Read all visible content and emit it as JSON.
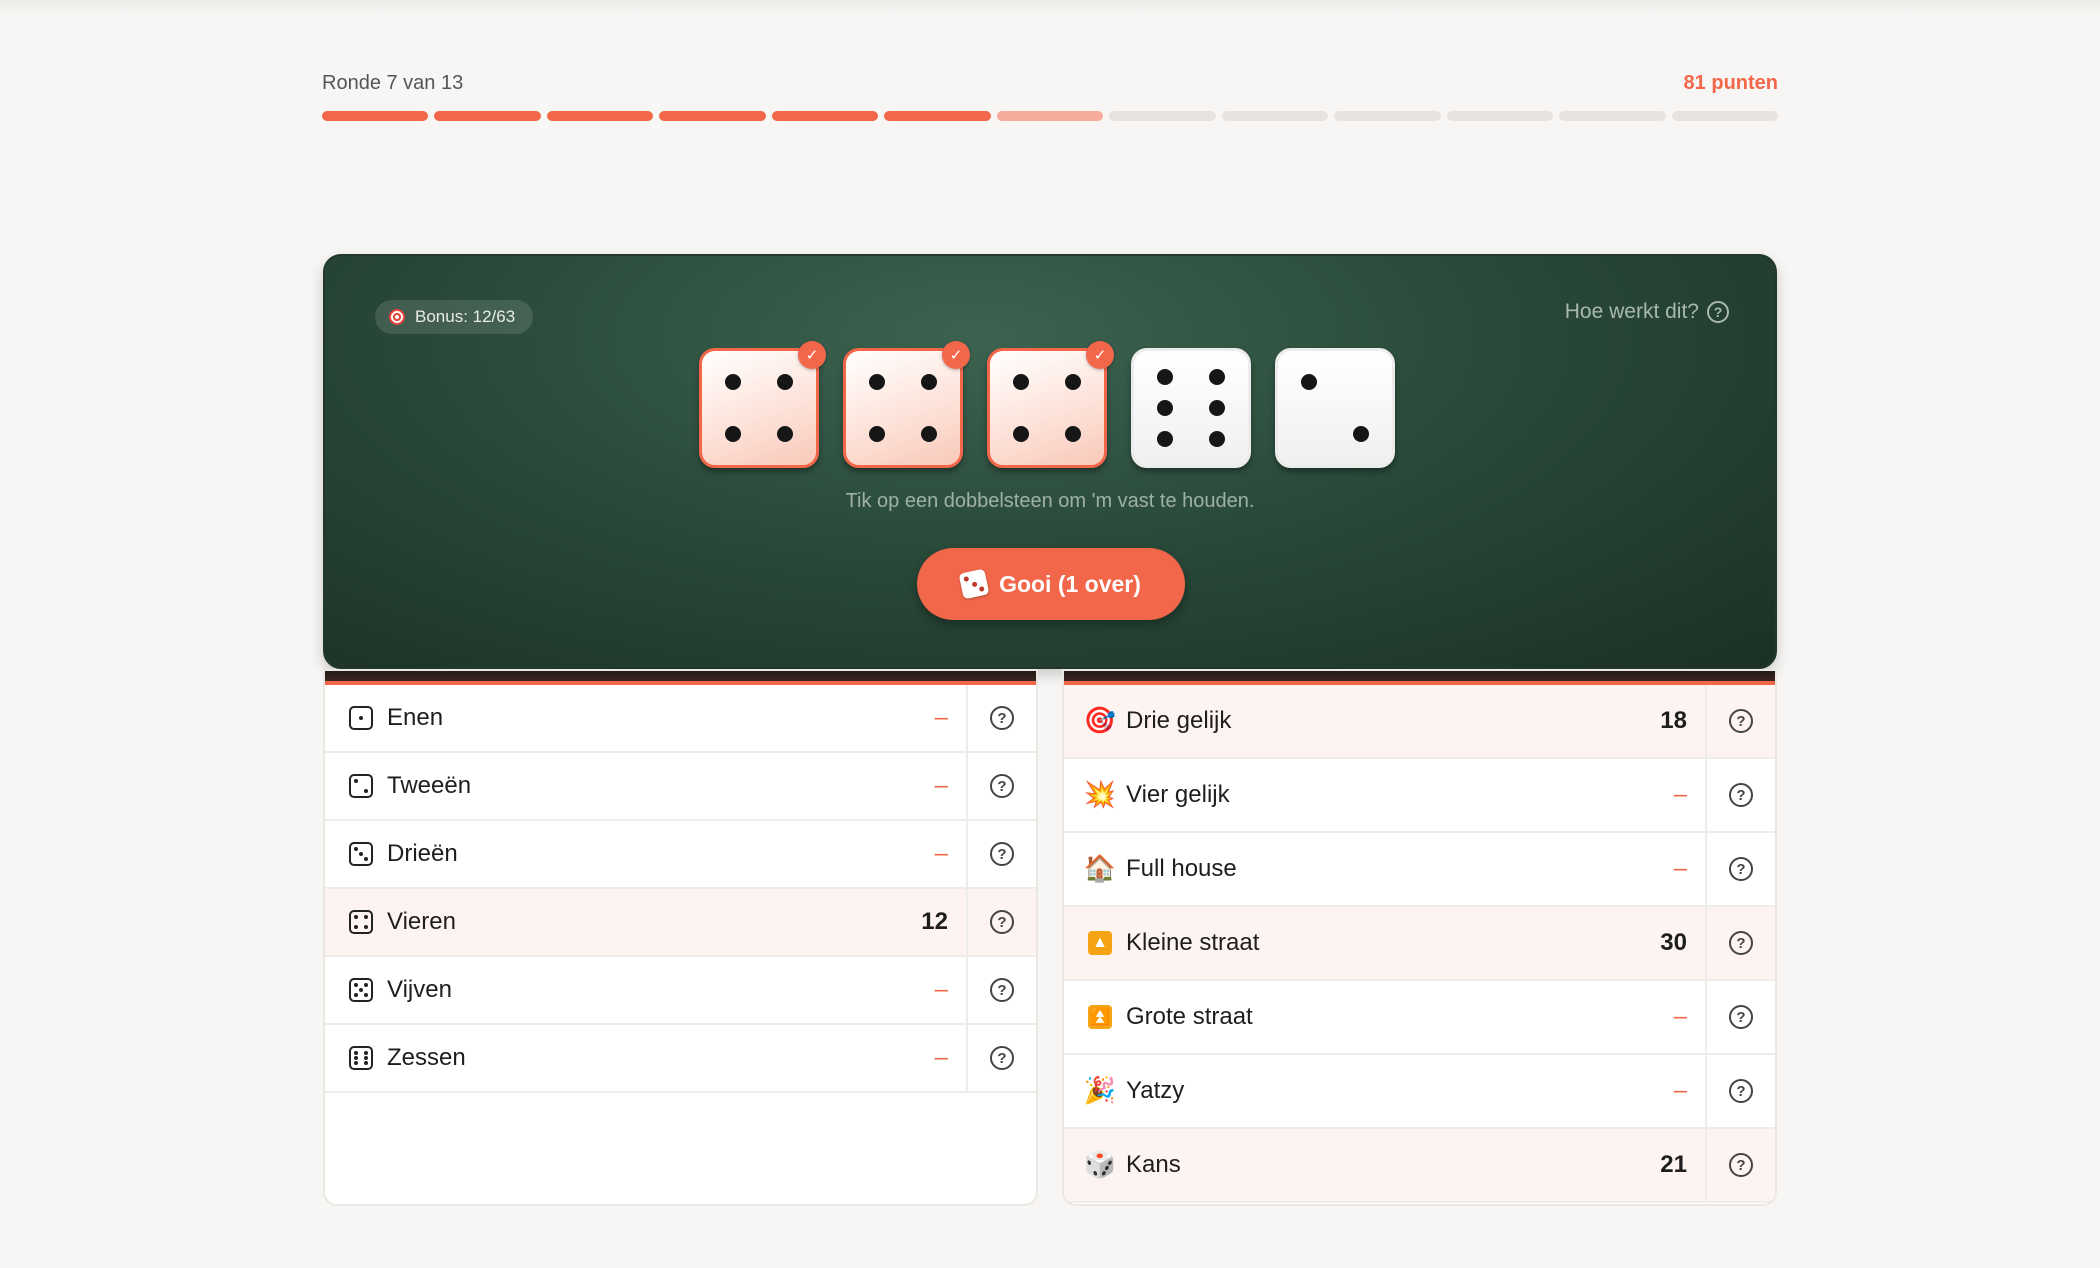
{
  "progress": {
    "round_label": "Ronde 7 van 13",
    "points_label": "81 punten",
    "total_rounds": 13,
    "completed_rounds": 6,
    "current_round": 7,
    "accent_color": "#f26749"
  },
  "table": {
    "bonus_label": "Bonus: 12/63",
    "bonus_icon": "target-icon",
    "how_label": "Hoe werkt dit?",
    "hint": "Tik op een dobbelsteen om 'm vast te houden.",
    "roll_button_label": "Gooi (1 over)",
    "roll_icon": "dice-icon",
    "dice": [
      {
        "value": 4,
        "held": true
      },
      {
        "value": 4,
        "held": true
      },
      {
        "value": 4,
        "held": true
      },
      {
        "value": 6,
        "held": false
      },
      {
        "value": 2,
        "held": false
      }
    ],
    "held_check": "✓"
  },
  "upper_section": [
    {
      "label": "Enen",
      "icon": "die-one-icon",
      "pips": 1,
      "score": "–",
      "filled": false
    },
    {
      "label": "Tweeën",
      "icon": "die-two-icon",
      "pips": 2,
      "score": "–",
      "filled": false
    },
    {
      "label": "Drieën",
      "icon": "die-three-icon",
      "pips": 3,
      "score": "–",
      "filled": false
    },
    {
      "label": "Vieren",
      "icon": "die-four-icon",
      "pips": 4,
      "score": "12",
      "filled": true
    },
    {
      "label": "Vijven",
      "icon": "die-five-icon",
      "pips": 5,
      "score": "–",
      "filled": false
    },
    {
      "label": "Zessen",
      "icon": "die-six-icon",
      "pips": 6,
      "score": "–",
      "filled": false
    }
  ],
  "lower_section": [
    {
      "label": "Drie gelijk",
      "icon": "target-icon",
      "glyph": "🎯",
      "score": "18",
      "filled": true
    },
    {
      "label": "Vier gelijk",
      "icon": "collision-icon",
      "glyph": "💥",
      "score": "–",
      "filled": false
    },
    {
      "label": "Full house",
      "icon": "house-icon",
      "glyph": "🏠",
      "score": "–",
      "filled": false
    },
    {
      "label": "Kleine straat",
      "icon": "up-triangle-icon",
      "glyph": "▲",
      "score": "30",
      "filled": true
    },
    {
      "label": "Grote straat",
      "icon": "double-up-icon",
      "glyph": "⏫",
      "score": "–",
      "filled": false
    },
    {
      "label": "Yatzy",
      "icon": "party-popper-icon",
      "glyph": "🎉",
      "score": "–",
      "filled": false
    },
    {
      "label": "Kans",
      "icon": "dice-icon",
      "glyph": "🎲",
      "score": "21",
      "filled": true
    }
  ],
  "help_glyph": "?"
}
